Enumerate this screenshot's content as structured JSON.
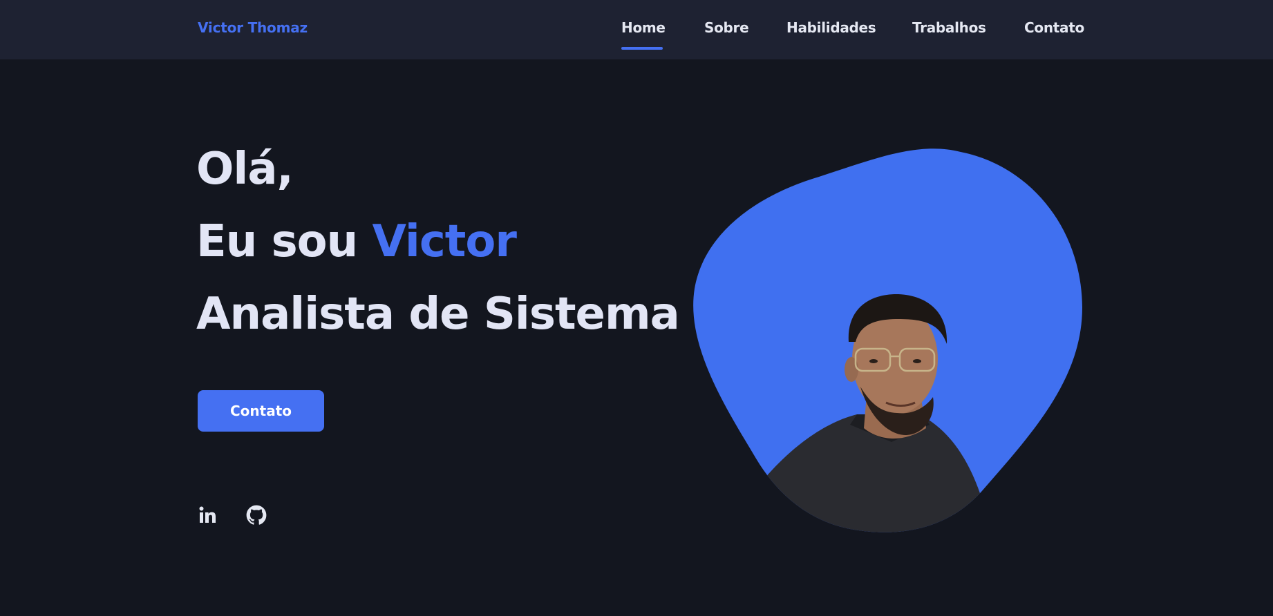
{
  "header": {
    "logo": "Victor Thomaz",
    "nav": [
      {
        "label": "Home",
        "active": true
      },
      {
        "label": "Sobre"
      },
      {
        "label": "Habilidades"
      },
      {
        "label": "Trabalhos"
      },
      {
        "label": "Contato"
      }
    ]
  },
  "hero": {
    "greeting": "Olá,",
    "intro_prefix": "Eu sou ",
    "intro_name": "Victor",
    "role": "Analista de Sistema",
    "cta_label": "Contato"
  },
  "social": [
    {
      "icon": "linkedin-icon"
    },
    {
      "icon": "github-icon"
    }
  ],
  "colors": {
    "accent": "#4570f2",
    "background": "#13161f",
    "header": "#1e2232",
    "text": "#e2e5f5"
  }
}
